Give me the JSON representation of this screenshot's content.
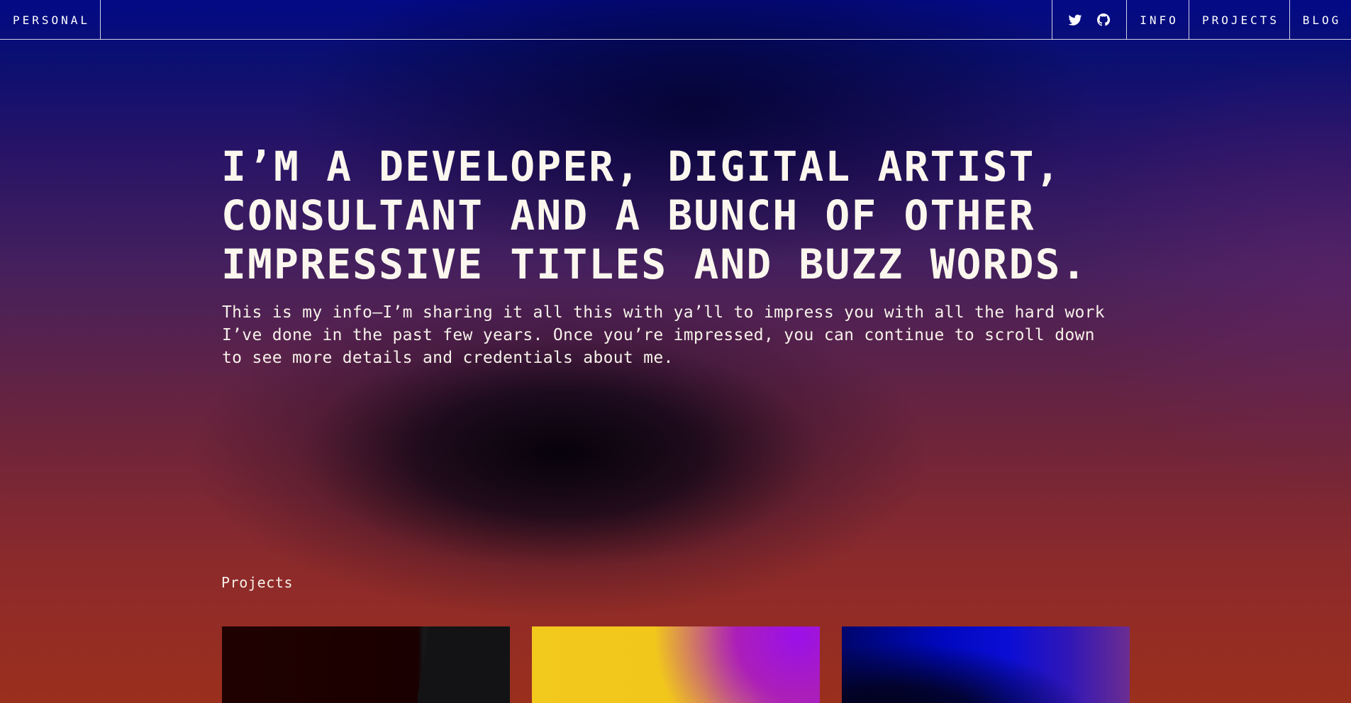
{
  "nav": {
    "brand": "PERSONAL",
    "social": [
      {
        "name": "twitter-icon"
      },
      {
        "name": "github-icon"
      }
    ],
    "links": [
      "INFO",
      "PROJECTS",
      "BLOG"
    ]
  },
  "hero": {
    "title": "I’M A DEVELOPER, DIGITAL ARTIST,\nCONSULTANT AND A BUNCH OF OTHER\nIMPRESSIVE TITLES AND BUZZ WORDS.",
    "copy": "This is my info—I’m sharing it all this with ya’ll to impress you with all the hard work\nI’ve done in the past few years. Once you’re impressed, you can continue to scroll down\nto see more details and credentials about me."
  },
  "projects": {
    "label": "Projects"
  },
  "colors": {
    "accent_blue": "#0008be",
    "accent_red": "#9b2f1d",
    "text": "#f4f1ea"
  }
}
